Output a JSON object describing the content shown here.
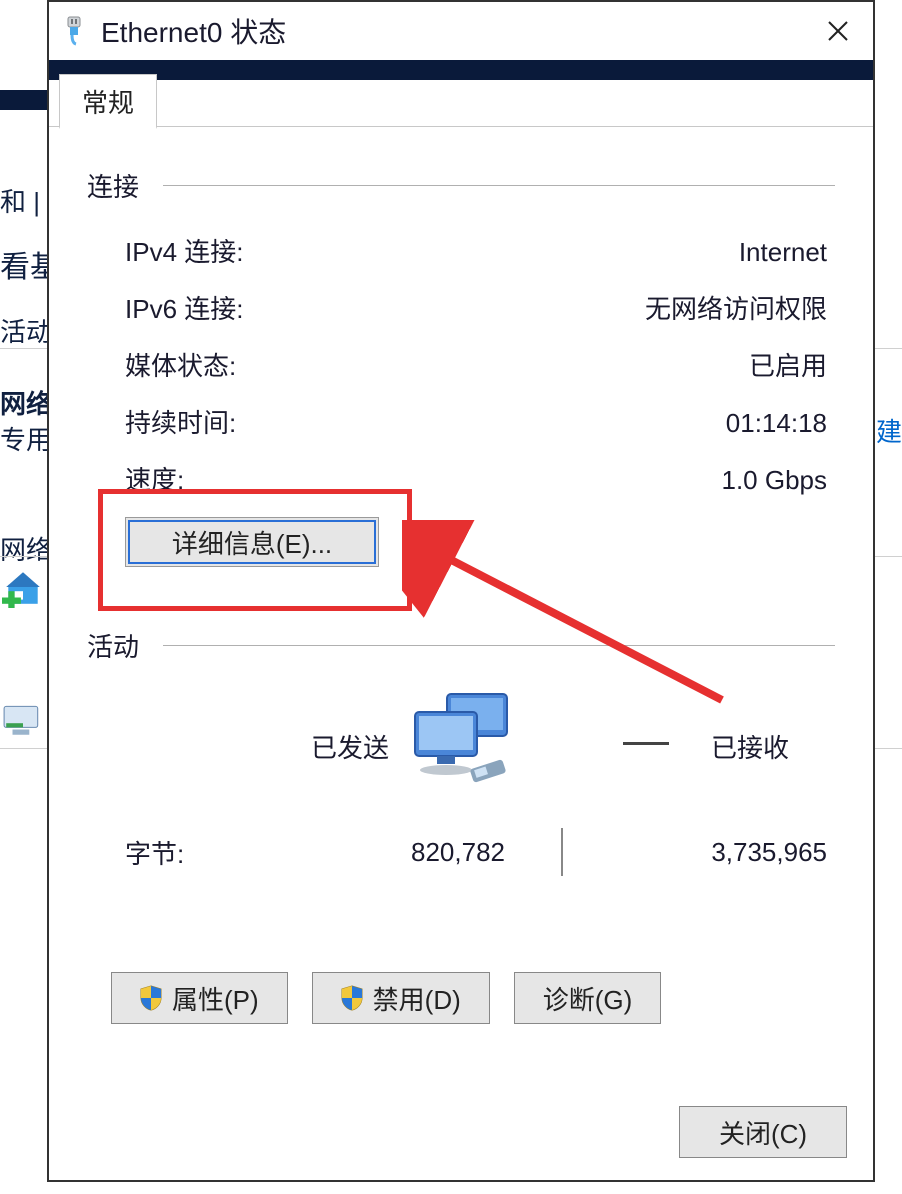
{
  "background": {
    "text_he": "和 |",
    "text_kanji": "看基",
    "text_huodong": "活动",
    "text_wangluo": "网络",
    "text_zhuanyong": "专用",
    "text_wangl2": "网络",
    "text_jian": "刂建"
  },
  "dialog": {
    "title": "Ethernet0 状态",
    "tab_general": "常规",
    "section_connection": "连接",
    "rows": {
      "ipv4_label": "IPv4 连接:",
      "ipv4_value": "Internet",
      "ipv6_label": "IPv6 连接:",
      "ipv6_value": "无网络访问权限",
      "media_label": "媒体状态:",
      "media_value": "已启用",
      "duration_label": "持续时间:",
      "duration_value": "01:14:18",
      "speed_label": "速度:",
      "speed_value": "1.0 Gbps"
    },
    "details_button": "详细信息(E)...",
    "section_activity": "活动",
    "activity": {
      "sent_label": "已发送",
      "recv_label": "已接收",
      "bytes_label": "字节:",
      "bytes_sent": "820,782",
      "bytes_recv": "3,735,965"
    },
    "buttons": {
      "properties": "属性(P)",
      "disable": "禁用(D)",
      "diagnose": "诊断(G)",
      "close": "关闭(C)"
    }
  }
}
